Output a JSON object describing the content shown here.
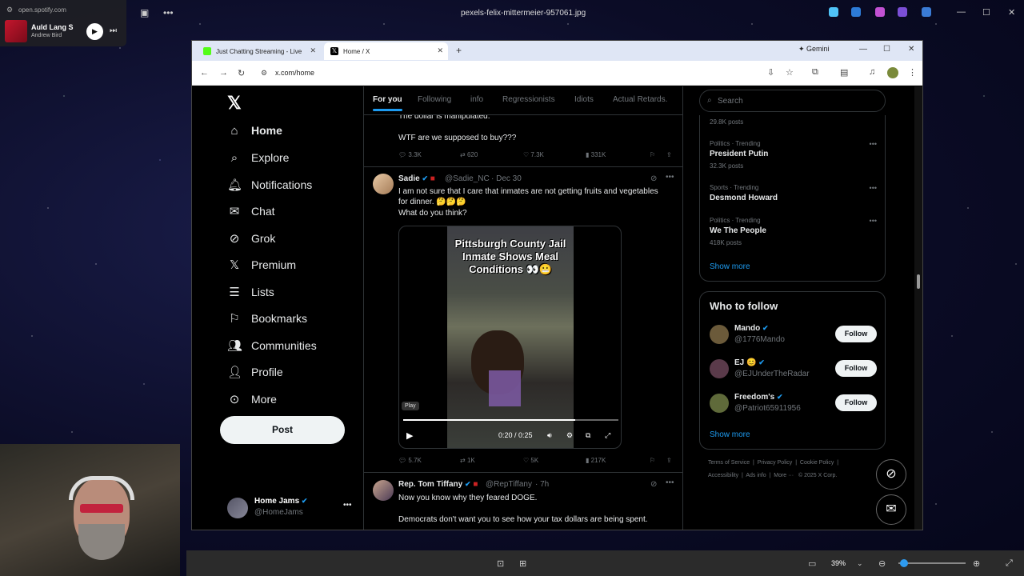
{
  "viewer": {
    "file_title": "pexels-felix-mittermeier-957061.jpg",
    "zoom": "39%"
  },
  "spotify": {
    "site": "open.spotify.com",
    "song": "Auld Lang S",
    "artist": "Andrew Bird"
  },
  "browser": {
    "tabs": [
      {
        "label": "Just Chatting Streaming - Live",
        "fav_color": "#53fc18"
      },
      {
        "label": "Home / X",
        "fav_color": "#000000"
      }
    ],
    "gemini": "Gemini",
    "url": "x.com/home"
  },
  "nav": {
    "items": [
      {
        "label": "Home",
        "icon": "home-icon"
      },
      {
        "label": "Explore",
        "icon": "search-icon"
      },
      {
        "label": "Notifications",
        "icon": "bell-icon"
      },
      {
        "label": "Chat",
        "icon": "mail-icon"
      },
      {
        "label": "Grok",
        "icon": "grok-icon"
      },
      {
        "label": "Premium",
        "icon": "x-icon"
      },
      {
        "label": "Lists",
        "icon": "list-icon"
      },
      {
        "label": "Bookmarks",
        "icon": "bookmark-icon"
      },
      {
        "label": "Communities",
        "icon": "communities-icon"
      },
      {
        "label": "Profile",
        "icon": "person-icon"
      },
      {
        "label": "More",
        "icon": "more-circle-icon"
      }
    ],
    "post_label": "Post",
    "account": {
      "name": "Home Jams",
      "handle": "@HomeJams"
    }
  },
  "feed": {
    "tabs": [
      "For you",
      "Following",
      "info",
      "Regressionists",
      "Idiots",
      "Actual Retards."
    ],
    "active_tab": "For you",
    "post1": {
      "line1": "The dollar is manipulated.",
      "line2": "WTF are we supposed to buy???",
      "replies": "3.3K",
      "reposts": "620",
      "likes": "7.3K",
      "views": "331K"
    },
    "post2": {
      "name": "Sadie",
      "handle": "@Sadie_NC",
      "date": "· Dec 30",
      "line1": "I am not sure that I care that inmates are not getting fruits and vegetables",
      "line2": "for dinner. 🤔🤔🤔",
      "line3": "What do you think?",
      "video_caption": "Pittsburgh County Jail Inmate Shows Meal Conditions 👀😬",
      "play_tooltip": "Play",
      "time": "0:20 / 0:25",
      "progress": 0.8,
      "replies": "5.7K",
      "reposts": "1K",
      "likes": "5K",
      "views": "217K"
    },
    "post3": {
      "name": "Rep. Tom Tiffany",
      "handle": "@RepTiffany",
      "date": "· 7h",
      "line1": "Now you know why they feared DOGE.",
      "line2": "Democrats don't want you to see how your tax dollars are being spent."
    }
  },
  "sidebar": {
    "search_placeholder": "Search",
    "trends": [
      {
        "meta": "29.8K posts",
        "name": "",
        "posts": ""
      },
      {
        "meta": "Politics · Trending",
        "name": "President Putin",
        "posts": "32.3K posts"
      },
      {
        "meta": "Sports · Trending",
        "name": "Desmond Howard",
        "posts": ""
      },
      {
        "meta": "Politics · Trending",
        "name": "We The People",
        "posts": "418K posts"
      }
    ],
    "show_more": "Show more",
    "who_to_follow": {
      "title": "Who to follow",
      "follow_label": "Follow",
      "accounts": [
        {
          "name": "Mando",
          "handle": "@1776Mando",
          "color": "#6b5a3a"
        },
        {
          "name": "EJ 😊",
          "handle": "@EJUnderTheRadar",
          "color": "#5a3a4a"
        },
        {
          "name": "Freedom's",
          "handle": "@Patriot65911956",
          "color": "#5f6a3a"
        }
      ]
    },
    "footer": {
      "line1": [
        "Terms of Service",
        "Privacy Policy",
        "Cookie Policy"
      ],
      "line2": [
        "Accessibility",
        "Ads info",
        "More ···",
        "© 2025 X Corp."
      ]
    }
  }
}
